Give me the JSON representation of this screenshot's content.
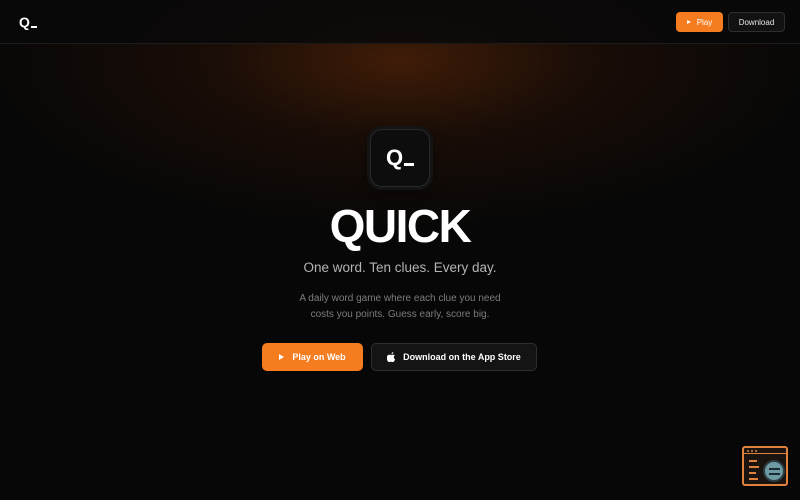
{
  "colors": {
    "accent": "#f57c1f",
    "background": "#070707",
    "secondary_button": "#141414"
  },
  "navbar": {
    "logo": {
      "letter": "Q",
      "icon": "quick-logo-icon"
    },
    "play_label": "Play",
    "play_icon": "play-triangle-icon",
    "download_label": "Download"
  },
  "hero": {
    "app_icon": {
      "letter": "Q",
      "icon": "quick-app-icon"
    },
    "title": "QUICK",
    "tagline": "One word. Ten clues. Every day.",
    "description_line1": "A daily word game where each clue you need",
    "description_line2": "costs you points. Guess early, score big.",
    "play_web_label": "Play on Web",
    "play_web_icon": "play-triangle-icon",
    "app_store_label": "Download on the App Store",
    "app_store_icon": "apple-icon"
  },
  "floating_widget": {
    "icon": "browser-inspect-icon"
  }
}
